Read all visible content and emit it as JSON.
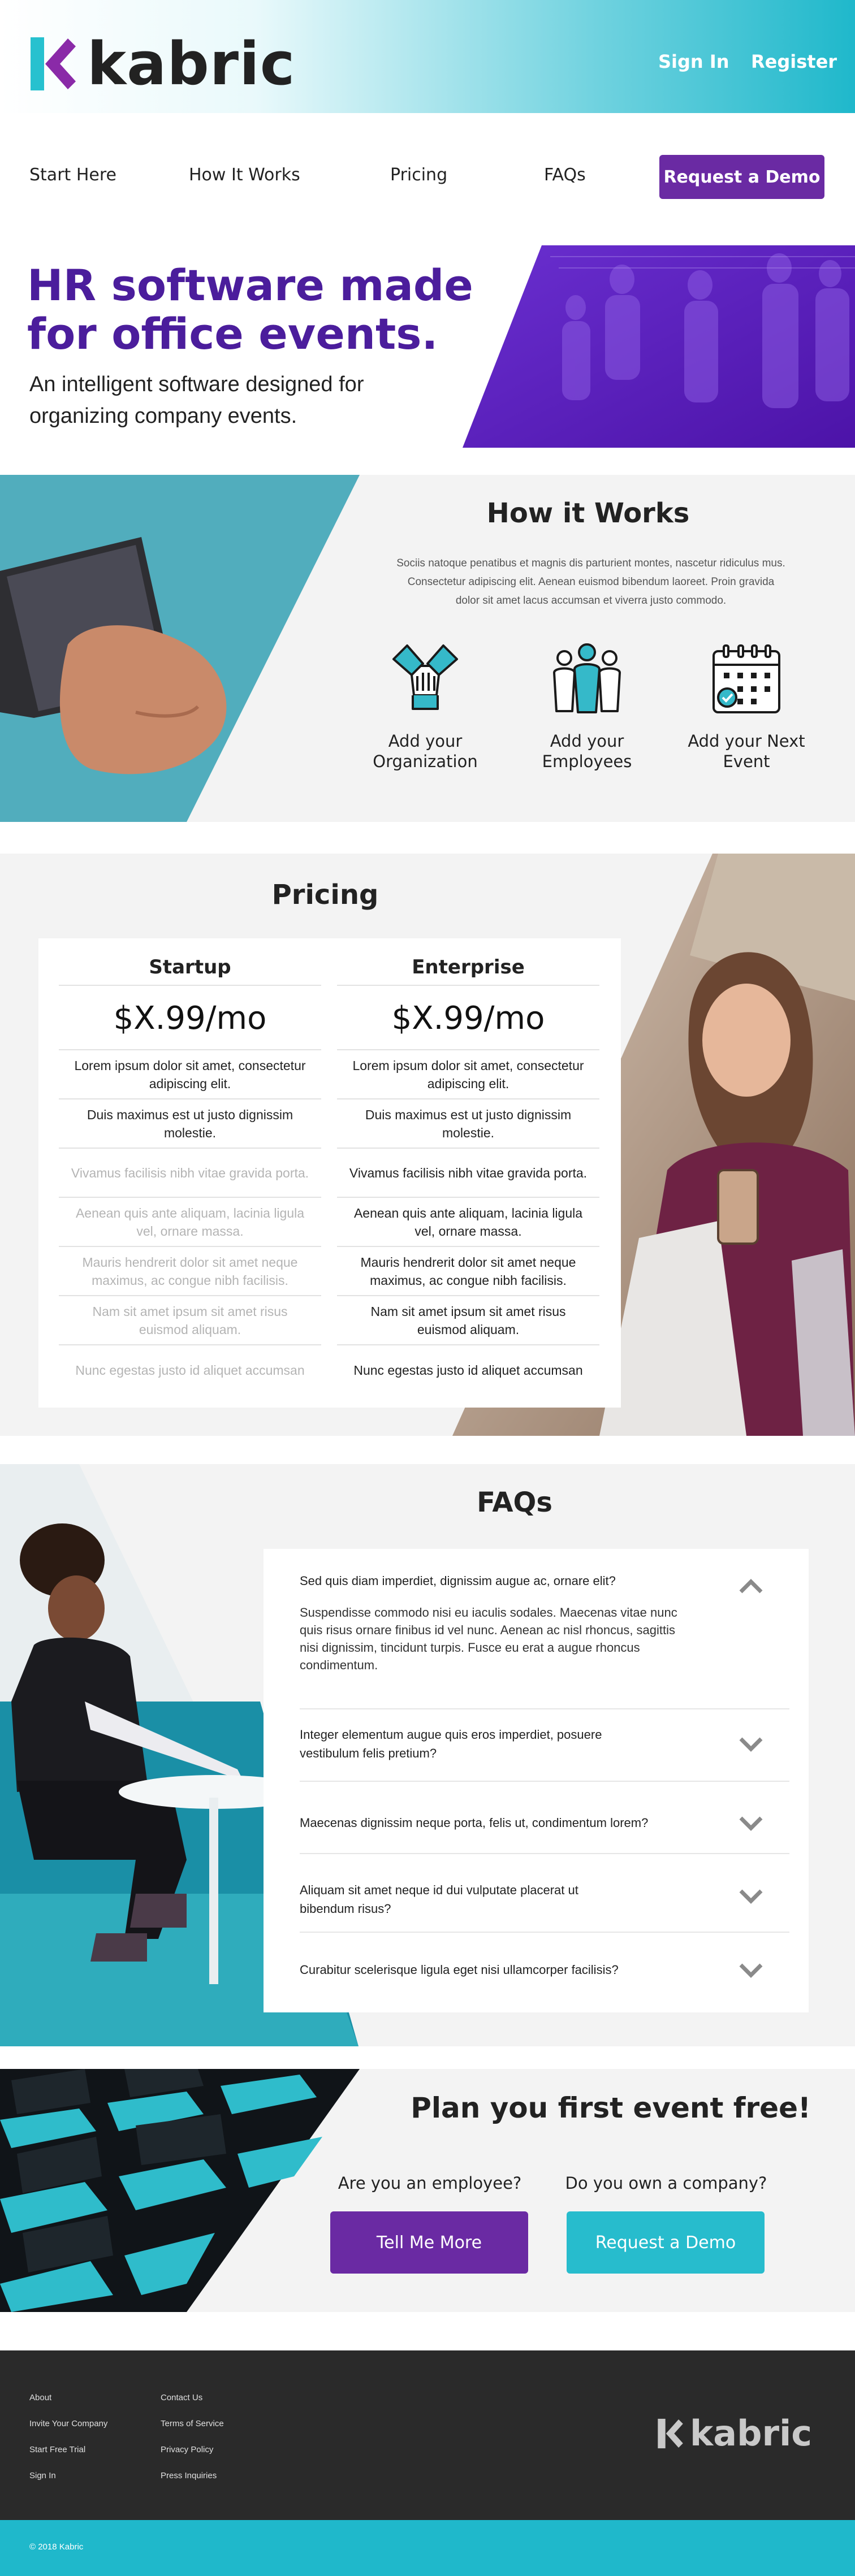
{
  "brand": {
    "name": "kabric",
    "accent": "#6a2aa3",
    "teal": "#1fb8cb",
    "hero_purple": "#4b1d9c"
  },
  "header": {
    "sign_in": "Sign In",
    "register": "Register"
  },
  "nav": {
    "items": [
      "Start Here",
      "How It Works",
      "Pricing",
      "FAQs"
    ],
    "demo_button": "Request a Demo"
  },
  "hero": {
    "title": "HR software made for office events.",
    "subtitle": "An intelligent software designed for organizing company events."
  },
  "how": {
    "title": "How it Works",
    "text": "Sociis natoque penatibus et magnis dis parturient montes, nascetur ridiculus mus. Consectetur adipiscing elit. Aenean euismod bibendum laoreet. Proin gravida dolor sit amet lacus accumsan et viverra justo commodo.",
    "steps": [
      {
        "label": "Add your Organization",
        "icon": "handshake-icon"
      },
      {
        "label": "Add your Employees",
        "icon": "people-icon"
      },
      {
        "label": "Add your Next Event",
        "icon": "calendar-icon"
      }
    ]
  },
  "pricing": {
    "title": "Pricing",
    "plans": [
      {
        "name": "Startup",
        "price": "$X.99/mo",
        "features": [
          {
            "text": "Lorem ipsum dolor sit amet, consectetur adipiscing elit.",
            "included": true
          },
          {
            "text": "Duis maximus est ut justo dignissim molestie.",
            "included": true
          },
          {
            "text": "Vivamus facilisis nibh vitae gravida porta.",
            "included": false
          },
          {
            "text": "Aenean quis ante aliquam, lacinia ligula vel, ornare massa.",
            "included": false
          },
          {
            "text": "Mauris hendrerit dolor sit amet neque maximus, ac congue nibh facilisis.",
            "included": false
          },
          {
            "text": "Nam sit amet ipsum sit amet risus euismod aliquam.",
            "included": false
          },
          {
            "text": "Nunc egestas justo id aliquet accumsan",
            "included": false
          }
        ]
      },
      {
        "name": "Enterprise",
        "price": "$X.99/mo",
        "features": [
          {
            "text": "Lorem ipsum dolor sit amet, consectetur adipiscing elit.",
            "included": true
          },
          {
            "text": "Duis maximus est ut justo dignissim molestie.",
            "included": true
          },
          {
            "text": "Vivamus facilisis nibh vitae gravida porta.",
            "included": true
          },
          {
            "text": "Aenean quis ante aliquam, lacinia ligula vel, ornare massa.",
            "included": true
          },
          {
            "text": "Mauris hendrerit dolor sit amet neque maximus, ac congue nibh facilisis.",
            "included": true
          },
          {
            "text": "Nam sit amet ipsum sit amet risus euismod aliquam.",
            "included": true
          },
          {
            "text": "Nunc egestas justo id aliquet accumsan",
            "included": true
          }
        ]
      }
    ]
  },
  "faq": {
    "title": "FAQs",
    "items": [
      {
        "q": "Sed quis diam imperdiet, dignissim augue ac, ornare elit?",
        "expanded": true,
        "a": "Suspendisse commodo nisi eu iaculis sodales. Maecenas vitae nunc quis risus ornare finibus id vel nunc. Aenean ac nisl rhoncus, sagittis nisi dignissim, tincidunt turpis. Fusce eu erat a augue rhoncus condimentum."
      },
      {
        "q": "Integer elementum augue quis eros imperdiet, posuere vestibulum felis pretium?",
        "expanded": false
      },
      {
        "q": "Maecenas dignissim neque porta, felis ut, condimentum lorem?",
        "expanded": false
      },
      {
        "q": "Aliquam sit amet neque id dui vulputate placerat ut bibendum risus?",
        "expanded": false
      },
      {
        "q": "Curabitur scelerisque ligula eget nisi ullamcorper facilisis?",
        "expanded": false
      }
    ]
  },
  "cta": {
    "title": "Plan you first event free!",
    "employee_q": "Are you an employee?",
    "company_q": "Do you own a company?",
    "employee_button": "Tell Me More",
    "company_button": "Request a Demo"
  },
  "footer": {
    "col1": [
      "About",
      "Invite Your Company",
      "Start Free Trial",
      "Sign In"
    ],
    "col2": [
      "Contact Us",
      "Terms of Service",
      "Privacy Policy",
      "Press Inquiries"
    ],
    "copyright": "© 2018 Kabric"
  }
}
